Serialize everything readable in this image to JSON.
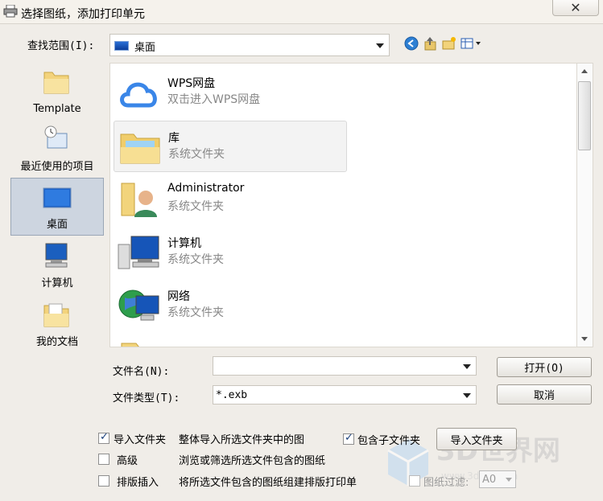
{
  "window": {
    "title": "选择图纸，添加打印单元",
    "close_label": "✕"
  },
  "lookin": {
    "label": "查找范围(I):",
    "value": "桌面"
  },
  "places": [
    {
      "label": "Template"
    },
    {
      "label": "最近使用的项目"
    },
    {
      "label": "桌面"
    },
    {
      "label": "计算机"
    },
    {
      "label": "我的文档"
    }
  ],
  "items": [
    {
      "name": "WPS网盘",
      "sub": "双击进入WPS网盘"
    },
    {
      "name": "库",
      "sub": "系统文件夹"
    },
    {
      "name": "Administrator",
      "sub": "系统文件夹"
    },
    {
      "name": "计算机",
      "sub": "系统文件夹"
    },
    {
      "name": "网络",
      "sub": "系统文件夹"
    }
  ],
  "filename": {
    "label": "文件名(N):",
    "value": ""
  },
  "filetype": {
    "label": "文件类型(T):",
    "value": "*.exb"
  },
  "buttons": {
    "open": "打开(O)",
    "cancel": "取消",
    "import_folder": "导入文件夹"
  },
  "options": {
    "import_folder": {
      "label": "导入文件夹",
      "desc": "整体导入所选文件夹中的图",
      "checked": true
    },
    "include_sub": {
      "label": "包含子文件夹",
      "checked": true
    },
    "advanced": {
      "label": "高级",
      "desc": "浏览或筛选所选文件包含的图纸",
      "checked": false
    },
    "layout_insert": {
      "label": "排版插入",
      "desc": "将所选文件包含的图纸组建排版打印单",
      "checked": false
    },
    "paper_filter": {
      "label": "图纸过滤:",
      "value": "A0",
      "checked": false
    }
  },
  "watermark": {
    "text": "3D世界网",
    "sub": "www.3dsjw.com"
  }
}
